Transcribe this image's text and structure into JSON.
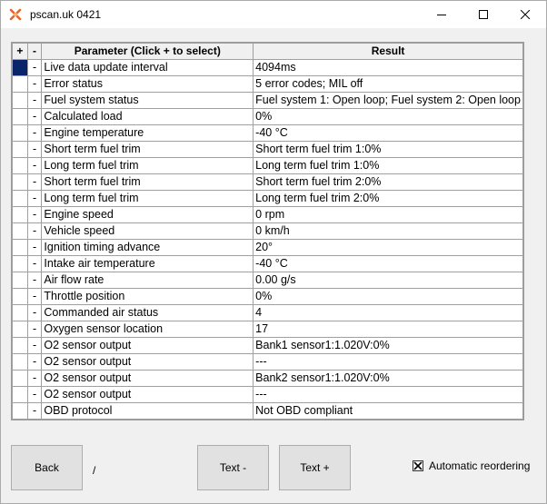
{
  "window": {
    "title": "pscan.uk 0421"
  },
  "grid": {
    "headers": {
      "plus": "+",
      "minus": "-",
      "parameter": "Parameter (Click + to select)",
      "result": "Result"
    },
    "rows": [
      {
        "marker": "-",
        "parameter": "Live data update interval",
        "result": "4094ms"
      },
      {
        "marker": "-",
        "parameter": "Error status",
        "result": "5 error codes;  MIL off"
      },
      {
        "marker": "-",
        "parameter": "Fuel system status",
        "result": "Fuel system 1: Open loop; Fuel system 2: Open loop"
      },
      {
        "marker": "-",
        "parameter": "Calculated load",
        "result": "0%"
      },
      {
        "marker": "-",
        "parameter": "Engine temperature",
        "result": "-40 °C"
      },
      {
        "marker": "-",
        "parameter": "Short term fuel trim",
        "result": "Short term fuel trim 1:0%"
      },
      {
        "marker": "-",
        "parameter": "Long term fuel trim",
        "result": "Long term fuel trim 1:0%"
      },
      {
        "marker": "-",
        "parameter": "Short term fuel trim",
        "result": "Short term fuel trim 2:0%"
      },
      {
        "marker": "-",
        "parameter": "Long term fuel trim",
        "result": "Long term fuel trim 2:0%"
      },
      {
        "marker": "-",
        "parameter": "Engine speed",
        "result": "0 rpm"
      },
      {
        "marker": "-",
        "parameter": "Vehicle speed",
        "result": "0 km/h"
      },
      {
        "marker": "-",
        "parameter": "Ignition timing advance",
        "result": "20°"
      },
      {
        "marker": "-",
        "parameter": "Intake air temperature",
        "result": "-40 °C"
      },
      {
        "marker": "-",
        "parameter": "Air flow rate",
        "result": "0.00 g/s"
      },
      {
        "marker": "-",
        "parameter": "Throttle position",
        "result": "0%"
      },
      {
        "marker": "-",
        "parameter": "Commanded air status",
        "result": "4"
      },
      {
        "marker": "-",
        "parameter": "Oxygen sensor location",
        "result": "17"
      },
      {
        "marker": "-",
        "parameter": "O2 sensor output",
        "result": "Bank1 sensor1:1.020V:0%"
      },
      {
        "marker": "-",
        "parameter": "O2 sensor output",
        "result": "---"
      },
      {
        "marker": "-",
        "parameter": "O2 sensor output",
        "result": "Bank2 sensor1:1.020V:0%"
      },
      {
        "marker": "-",
        "parameter": "O2 sensor output",
        "result": "---"
      },
      {
        "marker": "-",
        "parameter": "OBD protocol",
        "result": "Not OBD compliant"
      }
    ]
  },
  "buttons": {
    "back": "Back",
    "text_minus": "Text -",
    "text_plus": "Text +"
  },
  "page_indicator": "/",
  "auto_reorder": {
    "label": "Automatic reordering",
    "checked": true
  },
  "colors": {
    "selection": "#0a246a",
    "app_icon": "#e8632a"
  },
  "icons": {
    "app": "pscan-app-icon",
    "minimize": "minimize-icon",
    "maximize": "maximize-icon",
    "close": "close-icon"
  }
}
